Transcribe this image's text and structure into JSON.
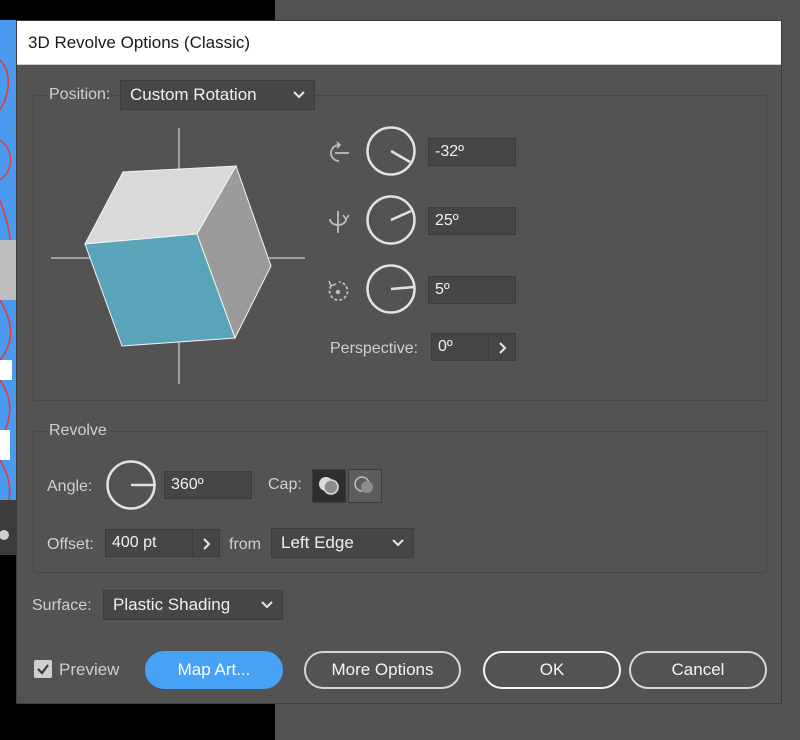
{
  "dialog": {
    "title": "3D Revolve Options (Classic)"
  },
  "position": {
    "label": "Position:",
    "preset": "Custom Rotation",
    "rotation_x": "-32º",
    "rotation_y": "25º",
    "rotation_z": "5º",
    "perspective_label": "Perspective:",
    "perspective_value": "0º"
  },
  "revolve": {
    "label": "Revolve",
    "angle_label": "Angle:",
    "angle_value": "360º",
    "cap_label": "Cap:",
    "offset_label": "Offset:",
    "offset_value": "400 pt",
    "from_label": "from",
    "from_value": "Left Edge"
  },
  "surface": {
    "label": "Surface:",
    "value": "Plastic Shading"
  },
  "footer": {
    "preview_label": "Preview",
    "preview_checked": true,
    "map_art_label": "Map Art...",
    "more_options_label": "More Options",
    "ok_label": "OK",
    "cancel_label": "Cancel"
  },
  "colors": {
    "accent": "#47a2f5",
    "cube_front": "#5aa4b9",
    "cube_top": "#d9d9d9",
    "cube_side": "#9b9b9b"
  },
  "icons": {
    "rotate_x": "rotate-x-axis-icon",
    "rotate_y": "rotate-y-axis-icon",
    "rotate_z": "rotate-z-axis-icon",
    "dropdown": "chevron-down-icon",
    "stepper": "chevron-right-icon",
    "cap_on": "cap-on-icon",
    "cap_off": "cap-off-icon",
    "check": "checkmark-icon"
  }
}
